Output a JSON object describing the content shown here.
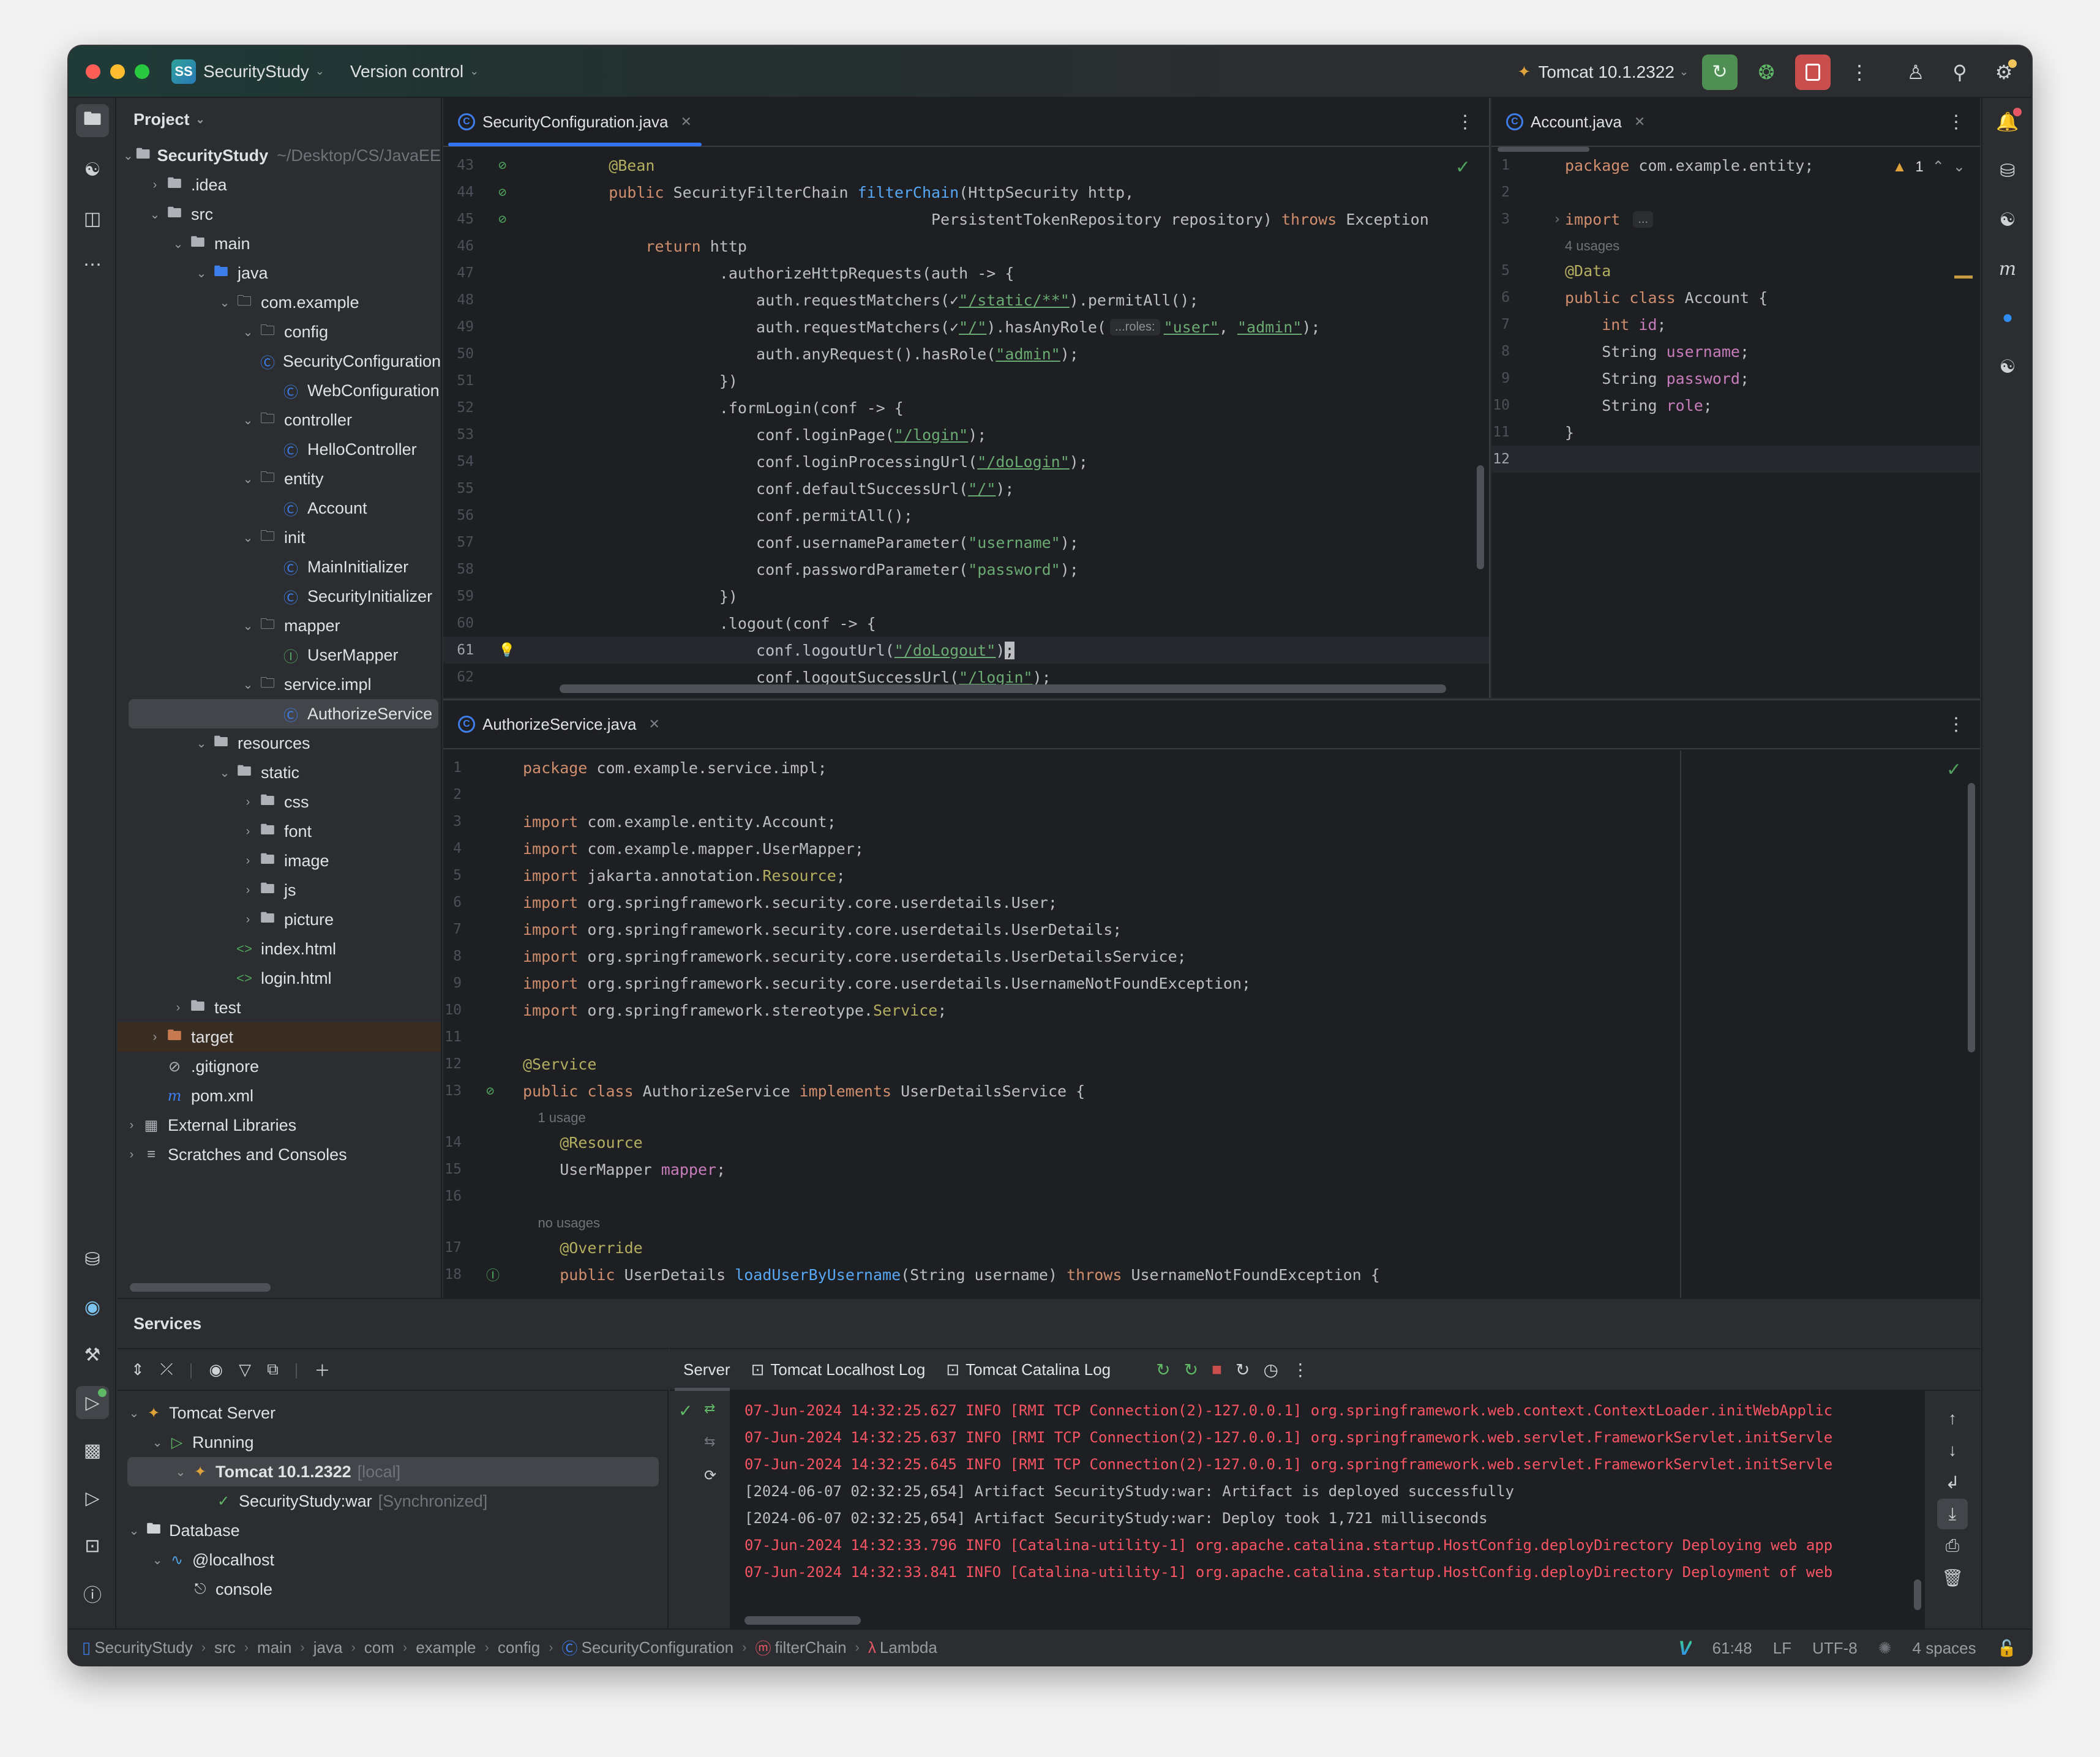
{
  "titlebar": {
    "project_badge": "SS",
    "project_name": "SecurityStudy",
    "vcs_label": "Version control",
    "run_config": "Tomcat 10.1.2322",
    "icons": [
      "rerun-icon",
      "debug-icon",
      "stop-icon",
      "more-icon",
      "add-user-icon",
      "search-icon",
      "settings-icon"
    ]
  },
  "project_panel": {
    "title": "Project",
    "tree": [
      {
        "label": "SecurityStudy",
        "suffix": "~/Desktop/CS/JavaEE",
        "icon": "module-folder",
        "depth": 0,
        "expanded": true,
        "bold": true
      },
      {
        "label": ".idea",
        "icon": "folder",
        "depth": 1,
        "expanded": false
      },
      {
        "label": "src",
        "icon": "folder",
        "depth": 1,
        "expanded": true
      },
      {
        "label": "main",
        "icon": "folder",
        "depth": 2,
        "expanded": true
      },
      {
        "label": "java",
        "icon": "source-folder",
        "depth": 3,
        "expanded": true
      },
      {
        "label": "com.example",
        "icon": "package",
        "depth": 4,
        "expanded": true
      },
      {
        "label": "config",
        "icon": "package",
        "depth": 5,
        "expanded": true
      },
      {
        "label": "SecurityConfiguration",
        "icon": "class",
        "depth": 6
      },
      {
        "label": "WebConfiguration",
        "icon": "class",
        "depth": 6
      },
      {
        "label": "controller",
        "icon": "package",
        "depth": 5,
        "expanded": true
      },
      {
        "label": "HelloController",
        "icon": "class",
        "depth": 6
      },
      {
        "label": "entity",
        "icon": "package",
        "depth": 5,
        "expanded": true
      },
      {
        "label": "Account",
        "icon": "class",
        "depth": 6
      },
      {
        "label": "init",
        "icon": "package",
        "depth": 5,
        "expanded": true
      },
      {
        "label": "MainInitializer",
        "icon": "class",
        "depth": 6
      },
      {
        "label": "SecurityInitializer",
        "icon": "class",
        "depth": 6
      },
      {
        "label": "mapper",
        "icon": "package",
        "depth": 5,
        "expanded": true
      },
      {
        "label": "UserMapper",
        "icon": "interface",
        "depth": 6
      },
      {
        "label": "service.impl",
        "icon": "package",
        "depth": 5,
        "expanded": true
      },
      {
        "label": "AuthorizeService",
        "icon": "class",
        "depth": 6,
        "selected": true
      },
      {
        "label": "resources",
        "icon": "resources-folder",
        "depth": 3,
        "expanded": true
      },
      {
        "label": "static",
        "icon": "folder",
        "depth": 4,
        "expanded": true
      },
      {
        "label": "css",
        "icon": "folder",
        "depth": 5,
        "expanded": false
      },
      {
        "label": "font",
        "icon": "folder",
        "depth": 5,
        "expanded": false
      },
      {
        "label": "image",
        "icon": "folder",
        "depth": 5,
        "expanded": false
      },
      {
        "label": "js",
        "icon": "folder",
        "depth": 5,
        "expanded": false
      },
      {
        "label": "picture",
        "icon": "folder",
        "depth": 5,
        "expanded": false
      },
      {
        "label": "index.html",
        "icon": "html",
        "depth": 4
      },
      {
        "label": "login.html",
        "icon": "html",
        "depth": 4
      },
      {
        "label": "test",
        "icon": "folder",
        "depth": 2,
        "expanded": false
      },
      {
        "label": "target",
        "icon": "excluded-folder",
        "depth": 1,
        "expanded": false,
        "excluded": true
      },
      {
        "label": ".gitignore",
        "icon": "ignore-file",
        "depth": 1
      },
      {
        "label": "pom.xml",
        "icon": "maven",
        "depth": 1
      },
      {
        "label": "External Libraries",
        "icon": "libraries",
        "depth": 0,
        "expanded": false
      },
      {
        "label": "Scratches and Consoles",
        "icon": "scratches",
        "depth": 0,
        "expanded": false
      }
    ]
  },
  "editor_security": {
    "tab": "SecurityConfiguration.java",
    "lines": [
      {
        "n": "43",
        "gutter": "bean-icon",
        "tokens": [
          [
            "an",
            "    @Bean"
          ]
        ]
      },
      {
        "n": "44",
        "gutter": "bean-icon",
        "tokens": [
          [
            "kw",
            "    public "
          ],
          [
            "src",
            "SecurityFilterChain "
          ],
          [
            "fn",
            "filterChain"
          ],
          [
            "src",
            "(HttpSecurity http,"
          ]
        ]
      },
      {
        "n": "45",
        "gutter": "bean-icon",
        "tokens": [
          [
            "src",
            "                                       PersistentTokenRepository repository) "
          ],
          [
            "kw",
            "throws "
          ],
          [
            "src",
            "Exception"
          ]
        ]
      },
      {
        "n": "46",
        "tokens": [
          [
            "kw",
            "        return "
          ],
          [
            "src",
            "http"
          ]
        ]
      },
      {
        "n": "47",
        "tokens": [
          [
            "src",
            "                .authorizeHttpRequests(auth -> {"
          ]
        ]
      },
      {
        "n": "48",
        "tokens": [
          [
            "src",
            "                    auth.requestMatchers(✓"
          ],
          [
            "url",
            "\"/static/**\""
          ],
          [
            "src",
            ").permitAll();"
          ]
        ]
      },
      {
        "n": "49",
        "tokens": [
          [
            "src",
            "                    auth.requestMatchers(✓"
          ],
          [
            "url",
            "\"/\""
          ],
          [
            "src",
            ").hasAnyRole("
          ],
          [
            "inlay",
            "...roles:"
          ],
          [
            "url",
            "\"user\""
          ],
          [
            "src",
            ", "
          ],
          [
            "url",
            "\"admin\""
          ],
          [
            "src",
            ");"
          ]
        ]
      },
      {
        "n": "50",
        "tokens": [
          [
            "src",
            "                    auth.anyRequest().hasRole("
          ],
          [
            "url",
            "\"admin\""
          ],
          [
            "src",
            ");"
          ]
        ]
      },
      {
        "n": "51",
        "tokens": [
          [
            "src",
            "                })"
          ]
        ]
      },
      {
        "n": "52",
        "tokens": [
          [
            "src",
            "                .formLogin(conf -> {"
          ]
        ]
      },
      {
        "n": "53",
        "tokens": [
          [
            "src",
            "                    conf.loginPage("
          ],
          [
            "url",
            "\"/login\""
          ],
          [
            "src",
            ");"
          ]
        ]
      },
      {
        "n": "54",
        "tokens": [
          [
            "src",
            "                    conf.loginProcessingUrl("
          ],
          [
            "url",
            "\"/doLogin\""
          ],
          [
            "src",
            ");"
          ]
        ]
      },
      {
        "n": "55",
        "tokens": [
          [
            "src",
            "                    conf.defaultSuccessUrl("
          ],
          [
            "url",
            "\"/\""
          ],
          [
            "src",
            ");"
          ]
        ]
      },
      {
        "n": "56",
        "tokens": [
          [
            "src",
            "                    conf.permitAll();"
          ]
        ]
      },
      {
        "n": "57",
        "tokens": [
          [
            "src",
            "                    conf.usernameParameter("
          ],
          [
            "str",
            "\"username\""
          ],
          [
            "src",
            ");"
          ]
        ]
      },
      {
        "n": "58",
        "tokens": [
          [
            "src",
            "                    conf.passwordParameter("
          ],
          [
            "str",
            "\"password\""
          ],
          [
            "src",
            ");"
          ]
        ]
      },
      {
        "n": "59",
        "tokens": [
          [
            "src",
            "                })"
          ]
        ]
      },
      {
        "n": "60",
        "tokens": [
          [
            "src",
            "                .logout(conf -> {"
          ]
        ]
      },
      {
        "n": "61",
        "gutter": "lightbulb-icon",
        "current": true,
        "tokens": [
          [
            "src",
            "                    conf.logoutUrl("
          ],
          [
            "url",
            "\"/doLogout\""
          ],
          [
            "src",
            ")"
          ],
          [
            "caret",
            ";"
          ]
        ]
      },
      {
        "n": "62",
        "tokens": [
          [
            "src",
            "                    conf.logoutSuccessUrl("
          ],
          [
            "url",
            "\"/login\""
          ],
          [
            "src",
            ");"
          ]
        ]
      }
    ]
  },
  "editor_account": {
    "tab": "Account.java",
    "warning_count": "1",
    "lines": [
      {
        "n": "1",
        "tokens": [
          [
            "kw",
            "package "
          ],
          [
            "src",
            "com.example.entity;"
          ]
        ]
      },
      {
        "n": "2",
        "tokens": []
      },
      {
        "n": "3",
        "fold": true,
        "tokens": [
          [
            "kw",
            "import "
          ],
          [
            "inlay",
            "..."
          ]
        ]
      },
      {
        "n": "",
        "hint": "4 usages"
      },
      {
        "n": "5",
        "tokens": [
          [
            "an",
            "@Data"
          ]
        ]
      },
      {
        "n": "6",
        "tokens": [
          [
            "kw",
            "public class "
          ],
          [
            "src",
            "Account {"
          ]
        ]
      },
      {
        "n": "7",
        "tokens": [
          [
            "kw",
            "    int "
          ],
          [
            "fld",
            "id"
          ],
          [
            "src",
            ";"
          ]
        ]
      },
      {
        "n": "8",
        "tokens": [
          [
            "src",
            "    String "
          ],
          [
            "fld",
            "username"
          ],
          [
            "src",
            ";"
          ]
        ]
      },
      {
        "n": "9",
        "tokens": [
          [
            "src",
            "    String "
          ],
          [
            "fld",
            "password"
          ],
          [
            "src",
            ";"
          ]
        ]
      },
      {
        "n": "10",
        "tokens": [
          [
            "src",
            "    String "
          ],
          [
            "fld",
            "role"
          ],
          [
            "src",
            ";"
          ]
        ]
      },
      {
        "n": "11",
        "tokens": [
          [
            "src",
            "}"
          ]
        ]
      },
      {
        "n": "12",
        "current": true,
        "tokens": []
      }
    ]
  },
  "editor_authorize": {
    "tab": "AuthorizeService.java",
    "lines": [
      {
        "n": "1",
        "tokens": [
          [
            "kw",
            "package "
          ],
          [
            "src",
            "com.example.service.impl;"
          ]
        ]
      },
      {
        "n": "2",
        "tokens": []
      },
      {
        "n": "3",
        "tokens": [
          [
            "kw",
            "import "
          ],
          [
            "src",
            "com.example.entity.Account;"
          ]
        ]
      },
      {
        "n": "4",
        "tokens": [
          [
            "kw",
            "import "
          ],
          [
            "src",
            "com.example.mapper.UserMapper;"
          ]
        ]
      },
      {
        "n": "5",
        "tokens": [
          [
            "kw",
            "import "
          ],
          [
            "src",
            "jakarta.annotation."
          ],
          [
            "an",
            "Resource"
          ],
          [
            "src",
            ";"
          ]
        ]
      },
      {
        "n": "6",
        "tokens": [
          [
            "kw",
            "import "
          ],
          [
            "src",
            "org.springframework.security.core.userdetails.User;"
          ]
        ]
      },
      {
        "n": "7",
        "tokens": [
          [
            "kw",
            "import "
          ],
          [
            "src",
            "org.springframework.security.core.userdetails.UserDetails;"
          ]
        ]
      },
      {
        "n": "8",
        "tokens": [
          [
            "kw",
            "import "
          ],
          [
            "src",
            "org.springframework.security.core.userdetails.UserDetailsService;"
          ]
        ]
      },
      {
        "n": "9",
        "tokens": [
          [
            "kw",
            "import "
          ],
          [
            "src",
            "org.springframework.security.core.userdetails.UsernameNotFoundException;"
          ]
        ]
      },
      {
        "n": "10",
        "tokens": [
          [
            "kw",
            "import "
          ],
          [
            "src",
            "org.springframework.stereotype."
          ],
          [
            "an",
            "Service"
          ],
          [
            "src",
            ";"
          ]
        ]
      },
      {
        "n": "11",
        "tokens": []
      },
      {
        "n": "12",
        "tokens": [
          [
            "an",
            "@Service"
          ]
        ]
      },
      {
        "n": "13",
        "gutter": "bean-icon",
        "tokens": [
          [
            "kw",
            "public class "
          ],
          [
            "src",
            "AuthorizeService "
          ],
          [
            "kw",
            "implements "
          ],
          [
            "src",
            "UserDetailsService {"
          ]
        ]
      },
      {
        "n": "",
        "hint": "    1 usage"
      },
      {
        "n": "14",
        "tokens": [
          [
            "an",
            "    @Resource"
          ]
        ]
      },
      {
        "n": "15",
        "tokens": [
          [
            "src",
            "    UserMapper "
          ],
          [
            "fld",
            "mapper"
          ],
          [
            "src",
            ";"
          ]
        ]
      },
      {
        "n": "16",
        "tokens": []
      },
      {
        "n": "",
        "hint": "    no usages"
      },
      {
        "n": "17",
        "tokens": [
          [
            "an",
            "    @Override"
          ]
        ]
      },
      {
        "n": "18",
        "gutter": "implements-icon",
        "tokens": [
          [
            "kw",
            "    public "
          ],
          [
            "src",
            "UserDetails "
          ],
          [
            "fn",
            "loadUserByUsername"
          ],
          [
            "src",
            "(String username) "
          ],
          [
            "kw",
            "throws "
          ],
          [
            "src",
            "UsernameNotFoundException {"
          ]
        ]
      }
    ]
  },
  "services": {
    "title": "Services",
    "tree": [
      {
        "label": "Tomcat Server",
        "icon": "tomcat",
        "depth": 0,
        "expanded": true
      },
      {
        "label": "Running",
        "icon": "run",
        "depth": 1,
        "expanded": true
      },
      {
        "label": "Tomcat 10.1.2322",
        "suffix": "[local]",
        "icon": "tomcat-running",
        "depth": 2,
        "expanded": true,
        "selected": true,
        "bold": true
      },
      {
        "label": "SecurityStudy:war",
        "suffix": "[Synchronized]",
        "icon": "artifact-ok",
        "depth": 3
      },
      {
        "label": "Database",
        "icon": "folder",
        "depth": 0,
        "expanded": true
      },
      {
        "label": "@localhost",
        "icon": "mysql",
        "depth": 1,
        "expanded": true
      },
      {
        "label": "console",
        "icon": "console-plug",
        "depth": 2
      }
    ],
    "console_tabs": [
      "Server",
      "Tomcat Localhost Log",
      "Tomcat Catalina Log"
    ],
    "active_tab": "Server",
    "log": [
      {
        "level": "err",
        "text": "07-Jun-2024 14:32:25.627 INFO [RMI TCP Connection(2)-127.0.0.1] org.springframework.web.context.ContextLoader.initWebApplic"
      },
      {
        "level": "err",
        "text": "07-Jun-2024 14:32:25.637 INFO [RMI TCP Connection(2)-127.0.0.1] org.springframework.web.servlet.FrameworkServlet.initServle"
      },
      {
        "level": "err",
        "text": "07-Jun-2024 14:32:25.645 INFO [RMI TCP Connection(2)-127.0.0.1] org.springframework.web.servlet.FrameworkServlet.initServle"
      },
      {
        "level": "info",
        "text": "[2024-06-07 02:32:25,654] Artifact SecurityStudy:war: Artifact is deployed successfully"
      },
      {
        "level": "info",
        "text": "[2024-06-07 02:32:25,654] Artifact SecurityStudy:war: Deploy took 1,721 milliseconds"
      },
      {
        "level": "err",
        "text": "07-Jun-2024 14:32:33.796 INFO [Catalina-utility-1] org.apache.catalina.startup.HostConfig.deployDirectory Deploying web app"
      },
      {
        "level": "err",
        "text": "07-Jun-2024 14:32:33.841 INFO [Catalina-utility-1] org.apache.catalina.startup.HostConfig.deployDirectory Deployment of web"
      }
    ]
  },
  "statusbar": {
    "breadcrumbs": [
      {
        "label": "SecurityStudy",
        "icon": "module-icon"
      },
      {
        "label": "src"
      },
      {
        "label": "main"
      },
      {
        "label": "java"
      },
      {
        "label": "com"
      },
      {
        "label": "example"
      },
      {
        "label": "config"
      },
      {
        "label": "SecurityConfiguration",
        "icon": "class-icon"
      },
      {
        "label": "filterChain",
        "icon": "method-icon"
      },
      {
        "label": "Lambda",
        "icon": "lambda-icon"
      }
    ],
    "position": "61:48",
    "line_sep": "LF",
    "encoding": "UTF-8",
    "indent": "4 spaces"
  },
  "colors": {
    "accent": "#3574f0",
    "run_green": "#4f8f54",
    "stop_red": "#c94f4f",
    "error_log": "#f75464"
  }
}
